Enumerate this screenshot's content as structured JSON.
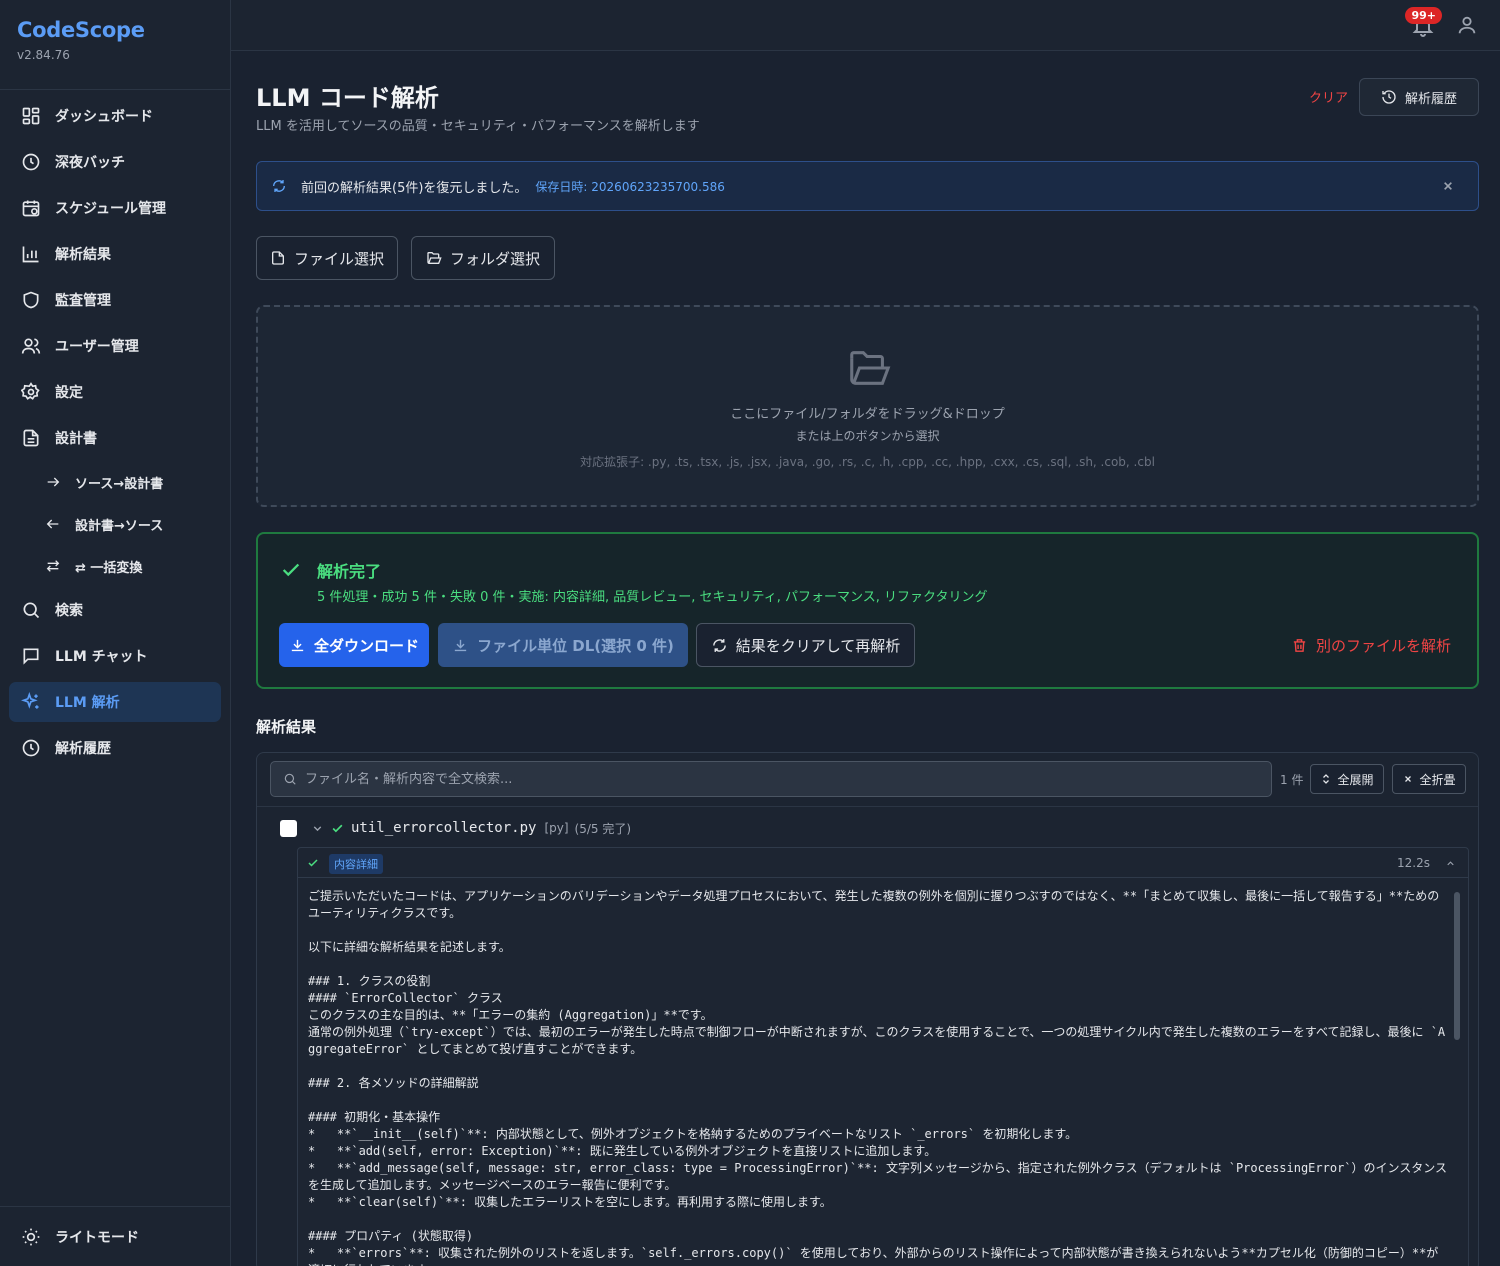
{
  "app": {
    "name": "CodeScope",
    "version": "v2.84.76"
  },
  "sidebar": {
    "items": [
      {
        "label": "ダッシュボード",
        "icon": "dashboard-icon"
      },
      {
        "label": "深夜バッチ",
        "icon": "clock-icon"
      },
      {
        "label": "スケジュール管理",
        "icon": "calendar-icon"
      },
      {
        "label": "解析結果",
        "icon": "bar-chart-icon"
      },
      {
        "label": "監査管理",
        "icon": "shield-icon"
      },
      {
        "label": "ユーザー管理",
        "icon": "users-icon"
      },
      {
        "label": "設定",
        "icon": "gear-icon"
      },
      {
        "label": "設計書",
        "icon": "document-icon"
      },
      {
        "label": "ソース→設計書",
        "icon": "arrow-right-icon"
      },
      {
        "label": "設計書→ソース",
        "icon": "arrow-left-icon"
      },
      {
        "label": "⇄ 一括変換",
        "icon": "swap-icon"
      },
      {
        "label": "検索",
        "icon": "search-icon"
      },
      {
        "label": "LLM チャット",
        "icon": "chat-icon"
      },
      {
        "label": "LLM 解析",
        "icon": "sparkle-icon",
        "active": true
      },
      {
        "label": "解析履歴",
        "icon": "clock-icon"
      }
    ],
    "theme_toggle": "ライトモード"
  },
  "header": {
    "notification_badge": "99+"
  },
  "page": {
    "title": "LLM コード解析",
    "subtitle": "LLM を活用してソースの品質・セキュリティ・パフォーマンスを解析します",
    "clear_label": "クリア",
    "history_label": "解析履歴"
  },
  "restore_banner": {
    "message": "前回の解析結果(5件)を復元しました。",
    "saved_at": "保存日時: 20260623235700.586"
  },
  "select": {
    "file_label": "ファイル選択",
    "folder_label": "フォルダ選択"
  },
  "dropzone": {
    "main": "ここにファイル/フォルダをドラッグ&ドロップ",
    "sub": "または上のボタンから選択",
    "extensions": "対応拡張子: .py, .ts, .tsx, .js, .jsx, .java, .go, .rs, .c, .h, .cpp, .cc, .hpp, .cxx, .cs, .sql, .sh, .cob, .cbl"
  },
  "complete": {
    "title": "解析完了",
    "summary": "5 件処理・成功 5 件・失敗 0 件・実施: 内容詳細, 品質レビュー, セキュリティ, パフォーマンス, リファクタリング",
    "download_all": "全ダウンロード",
    "download_per_file": "ファイル単位 DL(選択 0 件)",
    "clear_reanalyze": "結果をクリアして再解析",
    "analyze_other": "別のファイルを解析"
  },
  "results": {
    "heading": "解析結果",
    "search_placeholder": "ファイル名・解析内容で全文検索...",
    "count": "1 件",
    "expand_all": "全展開",
    "collapse_all": "全折畳",
    "file": {
      "name": "util_errorcollector.py",
      "type": "[py]",
      "status": "(5/5 完了)",
      "panel": {
        "tag": "内容詳細",
        "time": "12.2s",
        "body": "ご提示いただいたコードは、アプリケーションのバリデーションやデータ処理プロセスにおいて、発生した複数の例外を個別に握りつぶすのではなく、**「まとめて収集し、最後に一括して報告する」**ためのユーティリティクラスです。\n\n以下に詳細な解析結果を記述します。\n\n### 1. クラスの役割\n#### `ErrorCollector` クラス\nこのクラスの主な目的は、**「エラーの集約 (Aggregation)」**です。\n通常の例外処理（`try-except`）では、最初のエラーが発生した時点で制御フローが中断されますが、このクラスを使用することで、一つの処理サイクル内で発生した複数のエラーをすべて記録し、最後に `AggregateError` としてまとめて投げ直すことができます。\n\n### 2. 各メソッドの詳細解説\n\n#### 初期化・基本操作\n*   **`__init__(self)`**: 内部状態として、例外オブジェクトを格納するためのプライベートなリスト `_errors` を初期化します。\n*   **`add(self, error: Exception)`**: 既に発生している例外オブジェクトを直接リストに追加します。\n*   **`add_message(self, message: str, error_class: type = ProcessingError)`**: 文字列メッセージから、指定された例外クラス（デフォルトは `ProcessingError`）のインスタンスを生成して追加します。メッセージベースのエラー報告に便利です。\n*   **`clear(self)`**: 収集したエラーリストを空にします。再利用する際に使用します。\n\n#### プロパティ (状態取得)\n*   **`errors`**: 収集された例外のリストを返します。`self._errors.copy()` を使用しており、外部からのリスト操作によって内部状態が書き換えられないよう**カプセル化（防御的コピー）**が適切に行われています。"
      }
    }
  }
}
